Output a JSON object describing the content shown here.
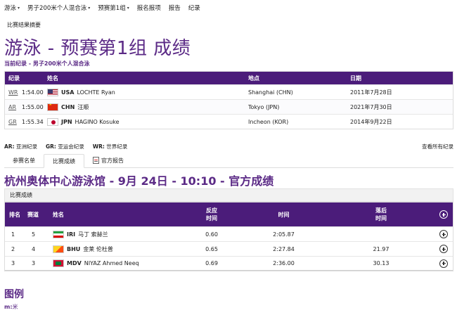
{
  "nav": {
    "items": [
      {
        "label": "游泳",
        "has_caret": true
      },
      {
        "label": "男子200米个人混合泳",
        "has_caret": true
      },
      {
        "label": "预赛第1组",
        "has_caret": true
      },
      {
        "label": "报名报项",
        "has_caret": false
      },
      {
        "label": "报告",
        "has_caret": false
      },
      {
        "label": "纪录",
        "has_caret": false
      }
    ],
    "caret": "▾"
  },
  "summary_link": "比赛结果摘要",
  "page_title": "游泳 - 预赛第1组 成绩",
  "current_record": "当前纪录 - 男子200米个人混合泳",
  "records": {
    "headers": {
      "code": "纪录",
      "name": "姓名",
      "place": "地点",
      "date": "日期"
    },
    "rows": [
      {
        "code": "WR",
        "score": "1:54.00",
        "country": "USA",
        "athlete": "LOCHTE Ryan",
        "flag": "usa",
        "place": "Shanghai (CHN)",
        "date": "2011年7月28日"
      },
      {
        "code": "AR",
        "score": "1:55.00",
        "country": "CHN",
        "athlete": "汪顺",
        "flag": "chn",
        "place": "Tokyo (JPN)",
        "date": "2021年7月30日"
      },
      {
        "code": "GR",
        "score": "1:55.34",
        "country": "JPN",
        "athlete": "HAGINO Kosuke",
        "flag": "jpn",
        "place": "Incheon (KOR)",
        "date": "2014年9月22日"
      }
    ]
  },
  "record_legend": [
    {
      "code": "AR:",
      "text": "亚洲纪录"
    },
    {
      "code": "GR:",
      "text": "亚运会纪录"
    },
    {
      "code": "WR:",
      "text": "世界纪录"
    }
  ],
  "view_all_records": "查看所有纪录",
  "tabs": [
    {
      "label": "参赛名单",
      "active": false
    },
    {
      "label": "比赛成绩",
      "active": true
    },
    {
      "label": "官方报告",
      "active": false,
      "icon": "report-icon"
    }
  ],
  "venue_title": "杭州奥体中心游泳馆 - 9月 24日 - 10:10 - 官方成绩",
  "results_caption": "比赛成绩",
  "results": {
    "headers": {
      "rank": "排名",
      "lane": "赛道",
      "name": "姓名",
      "reaction_1": "反应",
      "reaction_2": "时间",
      "time": "时间",
      "behind_1": "落后",
      "behind_2": "时间"
    },
    "rows": [
      {
        "rank": "1",
        "lane": "5",
        "country": "IRI",
        "athlete": "马丁 索赫兰",
        "flag": "iri",
        "reaction": "0.60",
        "time": "2:05.87",
        "behind": ""
      },
      {
        "rank": "2",
        "lane": "4",
        "country": "BHU",
        "athlete": "金莱 伦杜普",
        "flag": "bhu",
        "reaction": "0.65",
        "time": "2:27.84",
        "behind": "21.97"
      },
      {
        "rank": "3",
        "lane": "3",
        "country": "MDV",
        "athlete": "NIYAZ Ahmed Neeq",
        "flag": "mdv",
        "reaction": "0.69",
        "time": "2:36.00",
        "behind": "30.13"
      }
    ]
  },
  "legend_title": "图例",
  "legend_items": [
    {
      "code": "m:",
      "text": "米"
    }
  ],
  "colors": {
    "brand_purple": "#5b2a86",
    "header_purple": "#4b1c7a"
  }
}
